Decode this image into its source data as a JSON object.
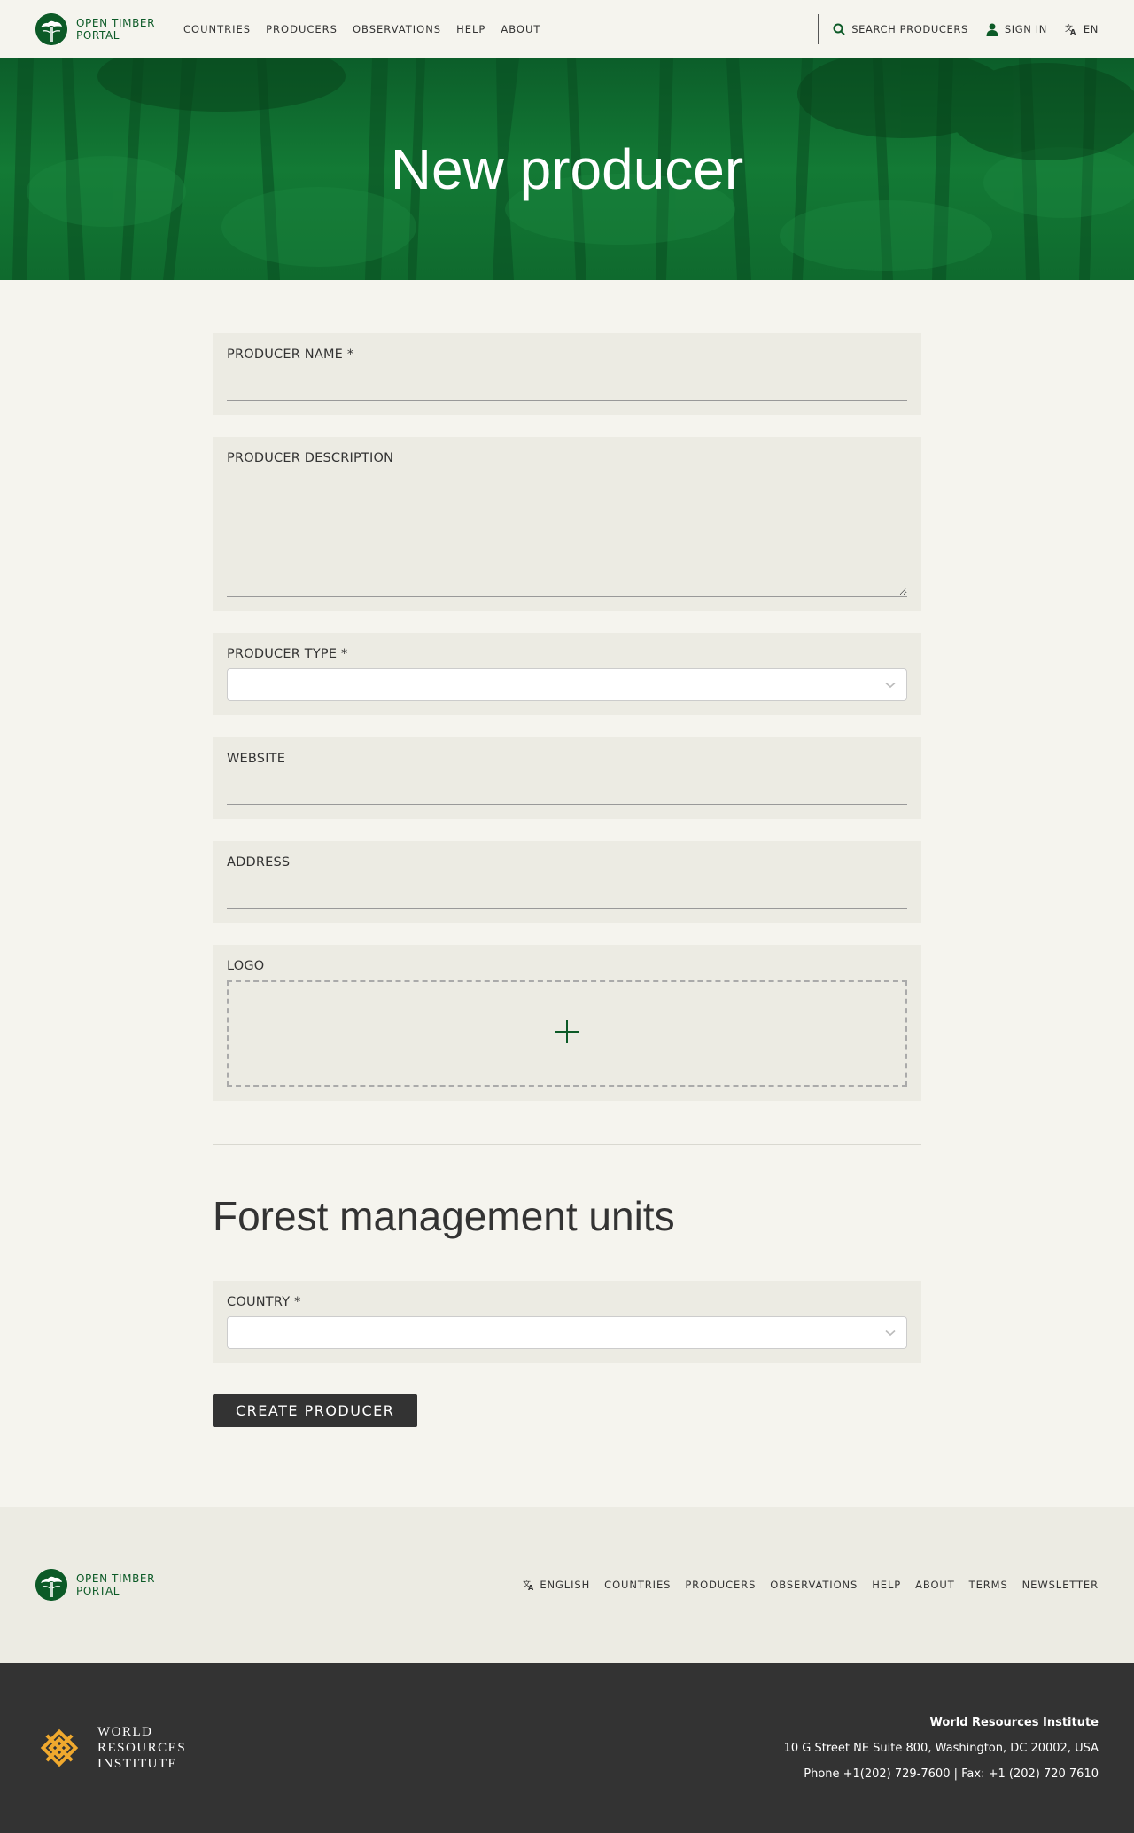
{
  "header": {
    "logo_line1": "OPEN TIMBER",
    "logo_line2": "PORTAL",
    "nav": [
      "COUNTRIES",
      "PRODUCERS",
      "OBSERVATIONS",
      "HELP",
      "ABOUT"
    ],
    "search_label": "SEARCH PRODUCERS",
    "signin_label": "SIGN IN",
    "language_label": "EN"
  },
  "hero": {
    "title": "New producer"
  },
  "form": {
    "producer_name_label": "PRODUCER NAME *",
    "producer_name_value": "",
    "producer_description_label": "PRODUCER DESCRIPTION",
    "producer_description_value": "",
    "producer_type_label": "PRODUCER TYPE *",
    "producer_type_value": "",
    "website_label": "WEBSITE",
    "website_value": "",
    "address_label": "ADDRESS",
    "address_value": "",
    "logo_label": "LOGO",
    "fmu_title": "Forest management units",
    "country_label": "COUNTRY *",
    "country_value": "",
    "submit_label": "CREATE PRODUCER"
  },
  "footer": {
    "logo_line1": "OPEN TIMBER",
    "logo_line2": "PORTAL",
    "language_label": "ENGLISH",
    "nav": [
      "COUNTRIES",
      "PRODUCERS",
      "OBSERVATIONS",
      "HELP",
      "ABOUT",
      "TERMS",
      "NEWSLETTER"
    ]
  },
  "footer_bottom": {
    "wri_line1": "WORLD",
    "wri_line2": "RESOURCES",
    "wri_line3": "INSTITUTE",
    "org_name": "World Resources Institute",
    "address": "10 G Street NE Suite 800, Washington, DC 20002, USA",
    "phone_fax": "Phone +1(202) 729-7600 | Fax: +1 (202) 720 7610"
  },
  "colors": {
    "brand_green": "#0c5a27",
    "background": "#f5f4ee",
    "field_background": "#ecebe3",
    "dark": "#333333",
    "wri_gold": "#f0a92e"
  },
  "icons": [
    "search-icon",
    "user-icon",
    "translate-icon",
    "chevron-down-icon",
    "plus-icon",
    "wri-logo-icon",
    "otp-logo-icon"
  ]
}
